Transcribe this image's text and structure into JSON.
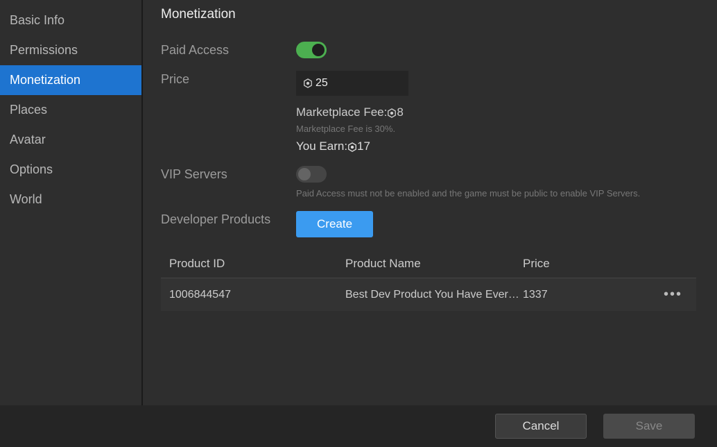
{
  "sidebar": {
    "items": [
      {
        "label": "Basic Info"
      },
      {
        "label": "Permissions"
      },
      {
        "label": "Monetization",
        "active": true
      },
      {
        "label": "Places"
      },
      {
        "label": "Avatar"
      },
      {
        "label": "Options"
      },
      {
        "label": "World"
      }
    ]
  },
  "page": {
    "title": "Monetization"
  },
  "paid_access": {
    "label": "Paid Access",
    "enabled": true
  },
  "price": {
    "label": "Price",
    "value": "25",
    "marketplace_fee_prefix": "Marketplace Fee:",
    "marketplace_fee_value": "8",
    "fee_note": "Marketplace Fee is 30%.",
    "you_earn_prefix": "You Earn:",
    "you_earn_value": "17"
  },
  "vip": {
    "label": "VIP Servers",
    "enabled": false,
    "note": "Paid Access must not be enabled and the game must be public to enable VIP Servers."
  },
  "dev_products": {
    "label": "Developer Products",
    "create_label": "Create",
    "columns": {
      "id": "Product ID",
      "name": "Product Name",
      "price": "Price"
    },
    "rows": [
      {
        "id": "1006844547",
        "name": "Best Dev Product You Have Ever…",
        "price": "1337"
      }
    ]
  },
  "footer": {
    "cancel": "Cancel",
    "save": "Save"
  }
}
